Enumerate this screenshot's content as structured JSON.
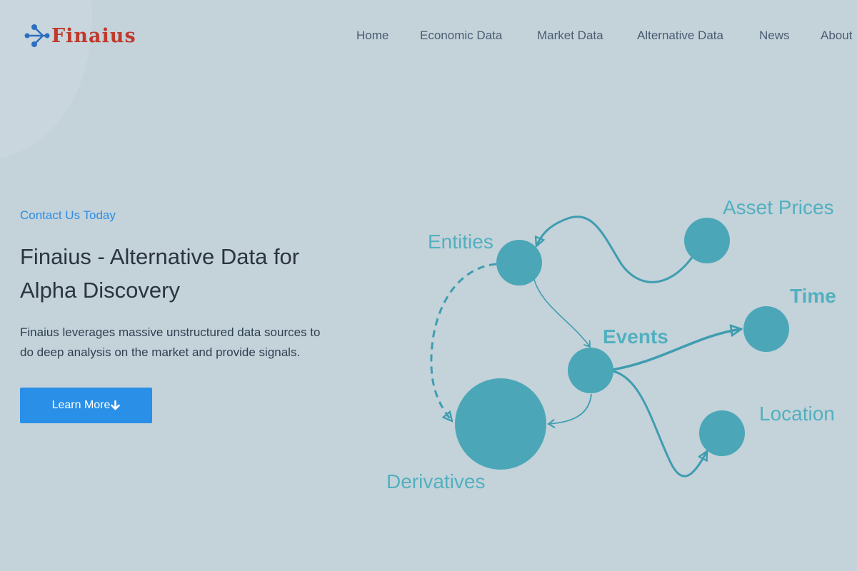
{
  "brand": {
    "name": "Finaius"
  },
  "nav": {
    "items": [
      "Home",
      "Economic Data",
      "Market Data",
      "Alternative Data",
      "News",
      "About"
    ]
  },
  "hero": {
    "kicker": "Contact Us Today",
    "title_line1": "Finaius - Alternative Data for",
    "title_line2": "Alpha Discovery",
    "desc_line1": "Finaius leverages massive unstructured data sources to",
    "desc_line2": "do deep analysis on the market and provide signals.",
    "button_label": "Learn More"
  },
  "diagram": {
    "nodes": {
      "entities": "Entities",
      "asset_prices": "Asset Prices",
      "time": "Time",
      "events": "Events",
      "location": "Location",
      "derivatives": "Derivatives"
    }
  },
  "colors": {
    "background": "#c4d2da",
    "accent": "#2c8de2",
    "node": "#4ba7b7",
    "node_label": "#52b0bf",
    "brand_text": "#c0392b"
  },
  "icons": [
    "logo-network-icon",
    "arrow-down-icon"
  ]
}
